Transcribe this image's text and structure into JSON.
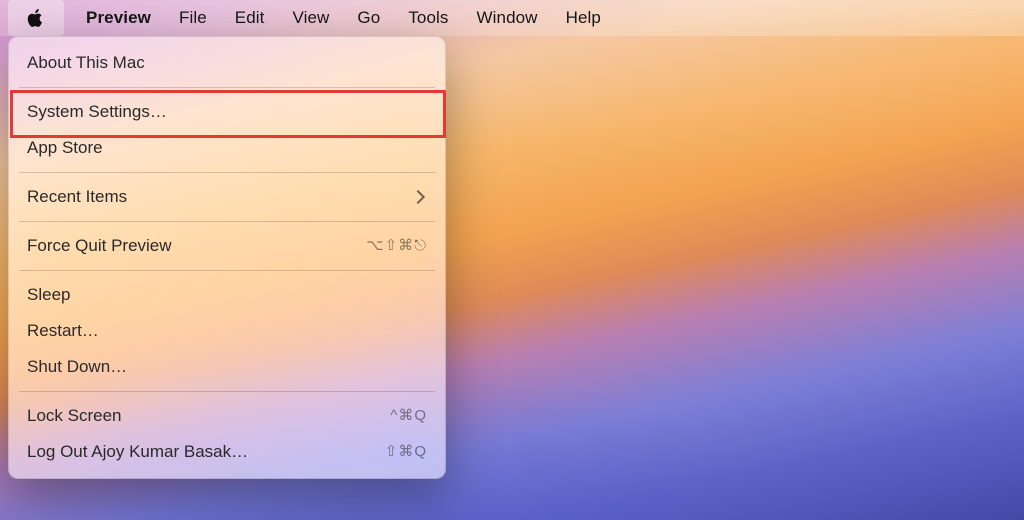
{
  "menubar": {
    "app_name": "Preview",
    "items": [
      "File",
      "Edit",
      "View",
      "Go",
      "Tools",
      "Window",
      "Help"
    ]
  },
  "apple_menu": {
    "about": "About This Mac",
    "system_settings": "System Settings…",
    "app_store": "App Store",
    "recent_items": "Recent Items",
    "force_quit": "Force Quit Preview",
    "force_quit_shortcut": "⌥⇧⌘⎋",
    "sleep": "Sleep",
    "restart": "Restart…",
    "shutdown": "Shut Down…",
    "lock_screen": "Lock Screen",
    "lock_screen_shortcut": "^⌘Q",
    "log_out": "Log Out Ajoy Kumar Basak…",
    "log_out_shortcut": "⇧⌘Q"
  },
  "annotation": {
    "highlight_target": "system_settings"
  }
}
